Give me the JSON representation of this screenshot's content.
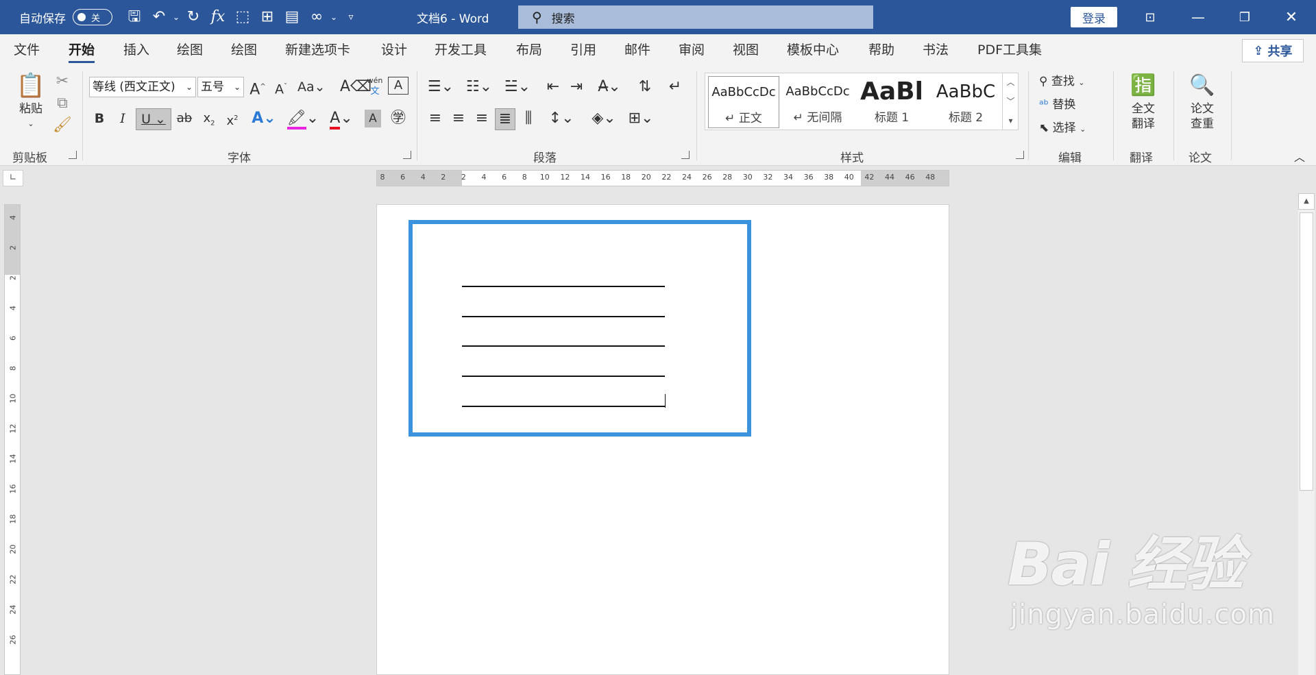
{
  "title_bar": {
    "autosave_label": "自动保存",
    "autosave_state": "关",
    "doc_title": "文档6  -  Word",
    "search_placeholder": "搜索",
    "login_label": "登录",
    "qat_icons": [
      "save-icon",
      "undo-icon",
      "redo-icon",
      "formula-icon",
      "select-icon",
      "org-chart-icon",
      "document-icon",
      "link-icon",
      "customize-icon"
    ],
    "window_buttons": [
      "ribbon-display-icon",
      "minimize-icon",
      "restore-icon",
      "close-icon"
    ]
  },
  "tabs": [
    "文件",
    "开始",
    "插入",
    "绘图",
    "绘图",
    "新建选项卡",
    "设计",
    "开发工具",
    "布局",
    "引用",
    "邮件",
    "审阅",
    "视图",
    "模板中心",
    "帮助",
    "书法",
    "PDF工具集"
  ],
  "active_tab": "开始",
  "share_label": "共享",
  "ribbon": {
    "clipboard": {
      "paste_label": "粘贴",
      "group_label": "剪贴板"
    },
    "font": {
      "font_name": "等线 (西文正文)",
      "font_size": "五号",
      "group_label": "字体",
      "pinyin_label": "wén"
    },
    "paragraph": {
      "group_label": "段落"
    },
    "styles": {
      "group_label": "样式",
      "items": [
        {
          "sample": "AaBbCcDc",
          "name": "↵ 正文"
        },
        {
          "sample": "AaBbCcDc",
          "name": "↵ 无间隔"
        },
        {
          "sample": "AaBl",
          "name": "标题 1"
        },
        {
          "sample": "AaBbC",
          "name": "标题 2"
        }
      ]
    },
    "editing": {
      "find": "查找",
      "replace": "替换",
      "select": "选择",
      "group_label": "编辑"
    },
    "translate": {
      "btn_label_1": "全文",
      "btn_label_2": "翻译",
      "group_label": "翻译"
    },
    "paper": {
      "btn_label_1": "论文",
      "btn_label_2": "查重",
      "group_label": "论文"
    }
  },
  "ruler": {
    "h_ticks": [
      "8",
      "6",
      "4",
      "2",
      "2",
      "4",
      "6",
      "8",
      "10",
      "12",
      "14",
      "16",
      "18",
      "20",
      "22",
      "24",
      "26",
      "28",
      "30",
      "32",
      "34",
      "36",
      "38",
      "40",
      "42",
      "44",
      "46",
      "48"
    ],
    "v_ticks": [
      "4",
      "2",
      "2",
      "4",
      "6",
      "8",
      "10",
      "12",
      "14",
      "16",
      "18",
      "20",
      "22",
      "24",
      "26"
    ]
  },
  "watermark": {
    "brand": "Bai 经验",
    "url": "jingyan.baidu.com"
  }
}
